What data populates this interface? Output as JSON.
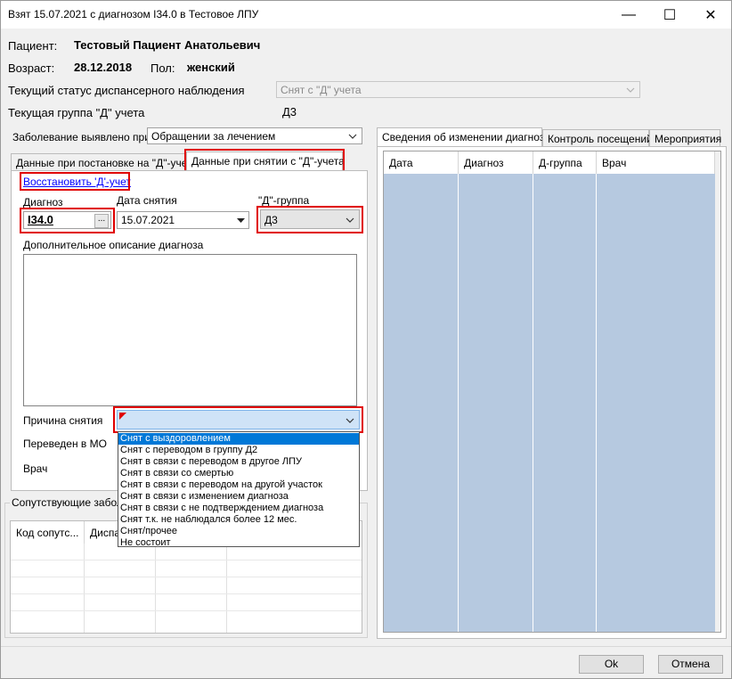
{
  "window": {
    "title": "Взят 15.07.2021 с диагнозом I34.0 в Тестовое ЛПУ",
    "minimize_glyph": "—",
    "maximize_glyph": "☐",
    "close_glyph": "✕"
  },
  "patient": {
    "patient_label": "Пациент:",
    "patient_name": "Тестовый Пациент Анатольевич",
    "age_label": "Возраст:",
    "birth_date": "28.12.2018",
    "sex_label": "Пол:",
    "sex_value": "женский",
    "status_label": "Текущий статус диспансерного наблюдения",
    "status_value": "Снят с \"Д\" учета",
    "group_label": "Текущая группа \"Д\" учета",
    "group_value": "Д3",
    "detected_label": "Заболевание выявлено при",
    "detected_value": "Обращении за лечением"
  },
  "left_tabs": [
    {
      "label": "Данные при постановке на \"Д\"-учет"
    },
    {
      "label": "Данные при снятии с \"Д\"-учета"
    }
  ],
  "removal": {
    "restore_link": "Восстановить 'Д'-учет",
    "diagnosis_label": "Диагноз",
    "diagnosis_value": "I34.0",
    "diagnosis_button": "...",
    "date_label": "Дата снятия",
    "date_value": "15.07.2021",
    "dgroup_label": "\"Д\"-группа",
    "dgroup_value": "Д3",
    "description_label": "Дополнительное описание диагноза",
    "description_value": "",
    "reason_label": "Причина снятия",
    "reason_value": "",
    "transferred_label": "Переведен в МО",
    "doctor_label": "Врач",
    "reason_options": [
      "Снят с выздоровлением",
      "Снят с переводом в группу Д2",
      "Снят в связи с переводом в другое ЛПУ",
      "Снят в связи со смертью",
      "Снят в связи с переводом на другой участок",
      "Снят в связи с изменением диагноза",
      "Снят в связи с не подтверждением диагноза",
      "Снят т.к. не наблюдался более 12 мес.",
      "Снят/прочее",
      "Не состоит"
    ],
    "selected_option": "Снят с выздоровлением"
  },
  "comorbid": {
    "group_label": "Сопутствующие заболе",
    "columns": [
      "Код сопутс...",
      "Диспа"
    ]
  },
  "right_tabs": [
    {
      "label": "Сведения об изменении диагноза"
    },
    {
      "label": "Контроль посещений"
    },
    {
      "label": "Мероприятия"
    }
  ],
  "history_grid": {
    "columns": [
      "Дата",
      "Диагноз",
      "Д-группа",
      "Врач"
    ],
    "row_color": "#b6c9e0"
  },
  "buttons": {
    "ok": "Ok",
    "cancel": "Отмена"
  },
  "colors": {
    "highlight_red": "#e00000",
    "selection_blue": "#0078d7",
    "link_blue": "#0000ff",
    "reason_field_bg": "#cfe3f7"
  }
}
